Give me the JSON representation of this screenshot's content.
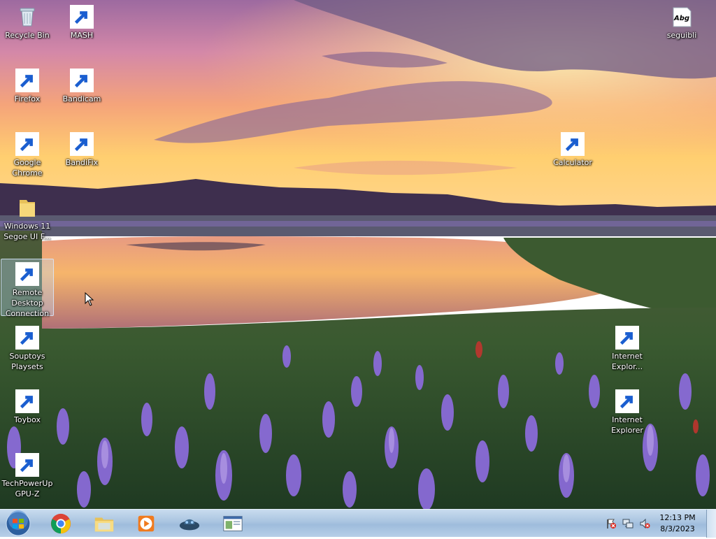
{
  "desktop": {
    "icons": {
      "recycle_bin": "Recycle Bin",
      "mash": "MASH",
      "firefox": "Firefox",
      "bandicam": "Bandicam",
      "chrome": "Google\nChrome",
      "bandifix": "BandiFix",
      "win11_font": "Windows 11\nSegoe UI F...",
      "remote_desktop": "Remote\nDesktop\nConnection",
      "souptoys": "Souptoys\nPlaysets",
      "toybox": "Toybox",
      "gpuz": "TechPowerUp\nGPU-Z",
      "seguibli": "seguibli",
      "seguibli_glyph": "Abg",
      "calculator": "Calculator",
      "ie_1": "Internet\nExplor...",
      "ie_2": "Internet\nExplorer"
    }
  },
  "taskbar": {
    "clock_time": "12:13 PM",
    "clock_date": "8/3/2023",
    "pinned": [
      "chrome-icon",
      "file-explorer-icon",
      "media-player-icon",
      "mash-icon",
      "remote-desktop-icon"
    ]
  },
  "colors": {
    "sky_top": "#b07aa0",
    "sunset_glow": "#ffc468",
    "taskbar": "#b3cbe4",
    "selection": "#bedcff"
  }
}
